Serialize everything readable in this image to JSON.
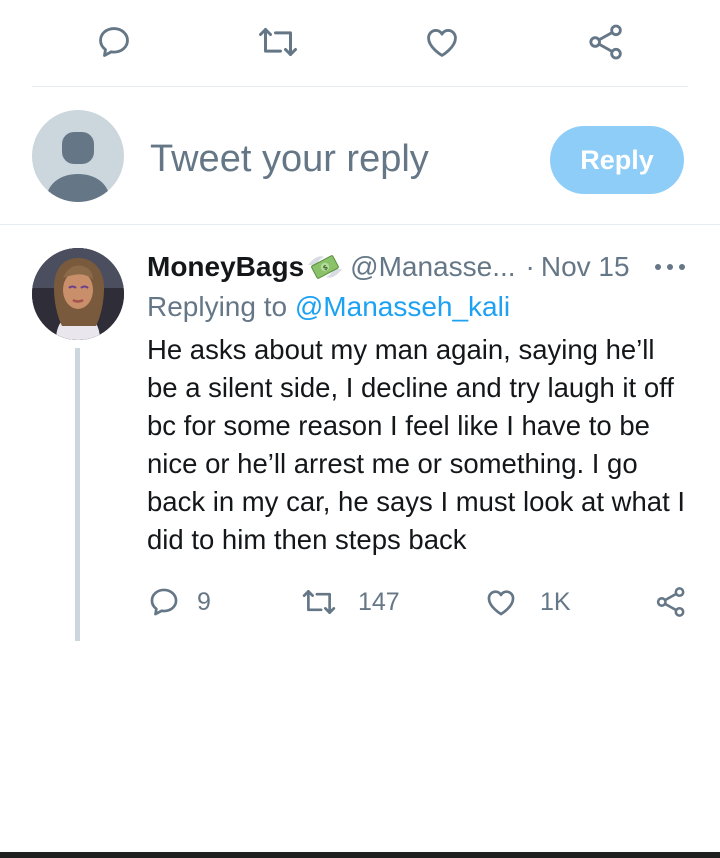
{
  "top_actions": {
    "reply_icon": "reply-icon",
    "retweet_icon": "retweet-icon",
    "like_icon": "like-icon",
    "share_icon": "share-icon"
  },
  "compose": {
    "placeholder": "Tweet your reply",
    "reply_button_label": "Reply",
    "avatar": "default-avatar"
  },
  "tweet": {
    "display_name": "MoneyBags",
    "name_emoji": "money-with-wings-emoji",
    "handle": "@Manasse...",
    "separator": "·",
    "timestamp": "Nov 15",
    "replying_prefix": "Replying to ",
    "replying_to": "@Manasseh_kali",
    "text": "He asks about my man again, saying he’ll be a silent side, I decline and try laugh it off bc for some reason I feel like I have to be nice or he’ll arrest me or something. I go back in my car, he says I must look at what I did to him then steps back",
    "reply_count": "9",
    "retweet_count": "147",
    "like_count": "1K"
  },
  "colors": {
    "accent": "#1da1f2",
    "reply_button": "#8ecdf8",
    "secondary_text": "#657786",
    "icon_gray": "#657786",
    "thread_line": "#ccd6dd"
  }
}
